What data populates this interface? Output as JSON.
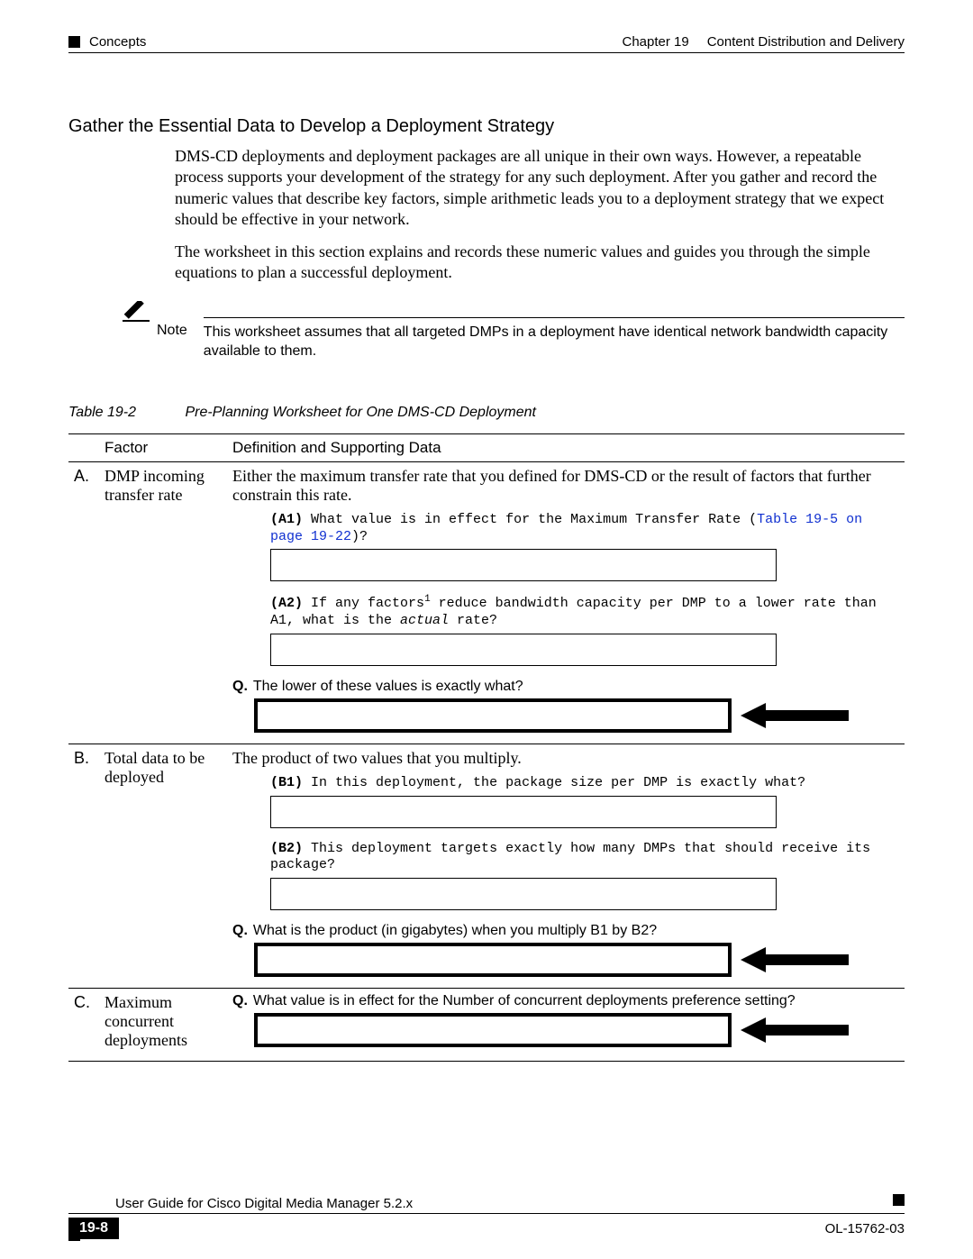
{
  "header": {
    "left": "Concepts",
    "chapter": "Chapter 19",
    "title": "Content Distribution and Delivery"
  },
  "section_title": "Gather the Essential Data to Develop a Deployment Strategy",
  "intro": {
    "p1": "DMS-CD deployments and deployment packages are all unique in their own ways. However, a repeatable process supports your development of the strategy for any such deployment. After you gather and record the numeric values that describe key factors, simple arithmetic leads you to a deployment strategy that we expect should be effective in your network.",
    "p2": "The worksheet in this section explains and records these numeric values and guides you through the simple equations to plan a successful deployment."
  },
  "note": {
    "label": "Note",
    "text": "This worksheet assumes that all targeted DMPs in a deployment have identical network bandwidth capacity available to them."
  },
  "table_caption": {
    "num": "Table 19-2",
    "title": "Pre-Planning Worksheet for One DMS-CD Deployment"
  },
  "headers": {
    "letter": "",
    "factor": "Factor",
    "def": "Definition and Supporting Data"
  },
  "rowA": {
    "letter": "A.",
    "factor": "DMP incoming transfer rate",
    "def": "Either the maximum transfer rate that you defined for DMS-CD or the result of factors that further constrain this rate.",
    "a1_pre": "(A1)",
    "a1": "What value is in effect for the Maximum Transfer Rate (",
    "a1_link": "Table 19-5 on page 19-22",
    "a1_post": ")?",
    "a2_pre": "(A2)",
    "a2_a": "If any factors",
    "a2_sup": "1",
    "a2_b": " reduce bandwidth capacity per DMP to a lower rate than A1, what is the ",
    "a2_i": "actual",
    "a2_c": " rate?",
    "q": "The lower of these values is exactly what?"
  },
  "rowB": {
    "letter": "B.",
    "factor": "Total data to be deployed",
    "def": "The product of two values that you multiply.",
    "b1_pre": "(B1)",
    "b1": "In this deployment, the package size per DMP is exactly what?",
    "b2_pre": "(B2)",
    "b2": "This deployment targets exactly how many DMPs that should receive its package?",
    "q": "What is the product (in gigabytes) when you multiply B1 by B2?"
  },
  "rowC": {
    "letter": "C.",
    "factor": "Maximum concurrent deployments",
    "q_a": "What value is in effect for ",
    "q_b": "the Number of concurrent deployments",
    "q_c": " preference setting?"
  },
  "footer": {
    "guide": "User Guide for Cisco Digital Media Manager 5.2.x",
    "page": "19-8",
    "doc": "OL-15762-03"
  }
}
